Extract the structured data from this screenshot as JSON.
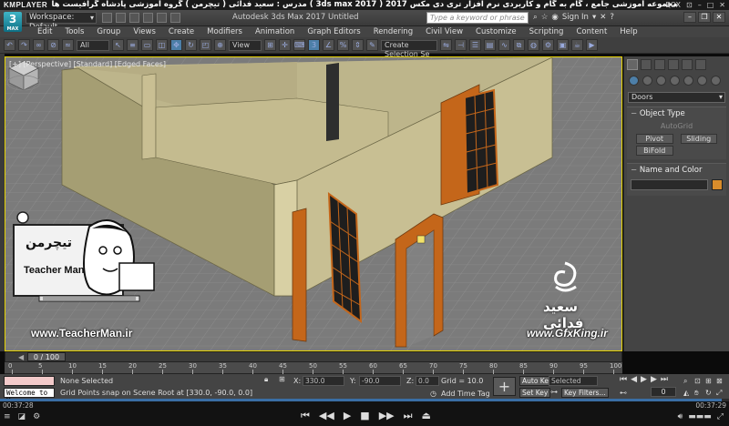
{
  "player": {
    "logo": "KMPLAYER",
    "title": "مجموعه آموزشی جامع ، گام به گام و کاربردی نرم افزار تری دی مکس 2017  ( 3ds max 2017 )  مدرس : سعید فدائی ( تیچرمن ) گروه آموزشی پادشاه گرافیست ها",
    "right_label": "BOX",
    "time_left": "00:37:28",
    "time_right": "00:37:29",
    "progress": 0.99
  },
  "app": {
    "workspace": "Workspace: Default",
    "title": "Autodesk 3ds Max 2017      Untitled",
    "search_placeholder": "Type a keyword or phrase",
    "sign_in": "Sign In",
    "logo_num": "3",
    "logo_sub": "MAX"
  },
  "menu": [
    "Edit",
    "Tools",
    "Group",
    "Views",
    "Create",
    "Modifiers",
    "Animation",
    "Graph Editors",
    "Rendering",
    "Civil View",
    "Customize",
    "Scripting",
    "Content",
    "Help"
  ],
  "toolbar": {
    "filter": "All",
    "ref_coord": "View",
    "selection_set": "Create Selection Se"
  },
  "viewport": {
    "label": "[+] [Perspective] [Standard] [Edged Faces]",
    "colors": {
      "wall": "#c8bf93",
      "wall_dark": "#9f986f",
      "floor": "#7c7c7c",
      "door_frame": "#c4661a",
      "door_panel": "#1c1c1c"
    }
  },
  "command_panel": {
    "category": "Doors",
    "object_type_title": "Object Type",
    "autogrid": "AutoGrid",
    "buttons": [
      "Pivot",
      "Sliding",
      "BiFold"
    ],
    "name_color_title": "Name and Color",
    "color": "#d98c2b"
  },
  "timeline": {
    "slider": "0 / 100",
    "ticks": [
      "0",
      "5",
      "10",
      "15",
      "20",
      "25",
      "30",
      "35",
      "40",
      "45",
      "50",
      "55",
      "60",
      "65",
      "70",
      "75",
      "80",
      "85",
      "90",
      "95",
      "100"
    ]
  },
  "status": {
    "selection": "None Selected",
    "prompt": "Grid Points snap on Scene Root at [330.0, -90.0, 0.0]",
    "x_label": "X:",
    "x_value": "330.0",
    "y_label": "Y:",
    "y_value": "-90.0",
    "z_label": "Z:",
    "z_value": "0.0",
    "grid": "Grid = 10.0",
    "add_time_tag": "Add Time Tag",
    "auto_key": "Auto Key",
    "selected": "Selected",
    "set_key": "Set Key",
    "key_filters": "Key Filters...",
    "welcome": "Welcome to M",
    "frame": "0"
  },
  "overlays": {
    "teacher_url": "www.TeacherMan.ir",
    "teacher_name": "Teacher Man",
    "teacher_fa": "تیچرمن",
    "gfx_url": "www.GfxKing.ir",
    "gfx_name": "سعید فدائی"
  }
}
